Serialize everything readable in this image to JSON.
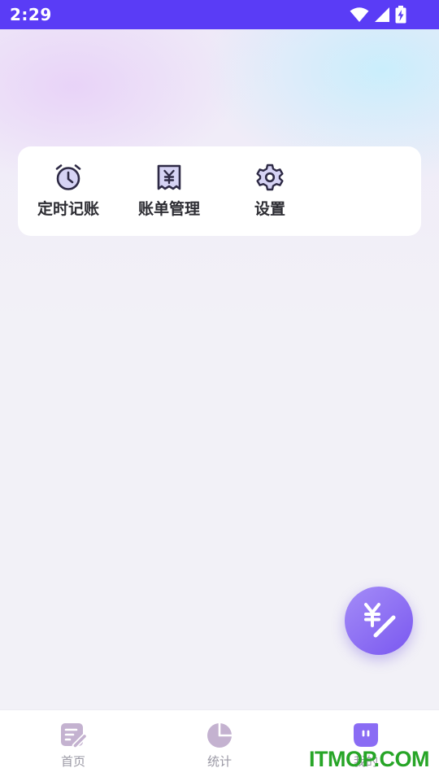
{
  "status_bar": {
    "time": "2:29",
    "icons": [
      "wifi-icon",
      "cellular-signal-icon",
      "battery-charging-icon"
    ],
    "background": "#5a3cf6"
  },
  "menu": {
    "items": [
      {
        "label": "定时记账",
        "icon": "alarm-clock-icon"
      },
      {
        "label": "账单管理",
        "icon": "yuan-bill-icon"
      },
      {
        "label": "设置",
        "icon": "gear-icon"
      }
    ]
  },
  "fab": {
    "icon": "yuan-pen-icon",
    "color": "#8a6cf4"
  },
  "bottom_nav": {
    "items": [
      {
        "label": "首页",
        "icon": "notes-edit-icon",
        "active": false
      },
      {
        "label": "统计",
        "icon": "pie-chart-icon",
        "active": false
      },
      {
        "label": "我的",
        "icon": "chat-face-icon",
        "active": true
      }
    ],
    "inactive_color": "#c4b2d0",
    "active_color": "#8a6cf4"
  },
  "watermark": {
    "text": "ITMOP.COM",
    "color": "#27a527"
  }
}
